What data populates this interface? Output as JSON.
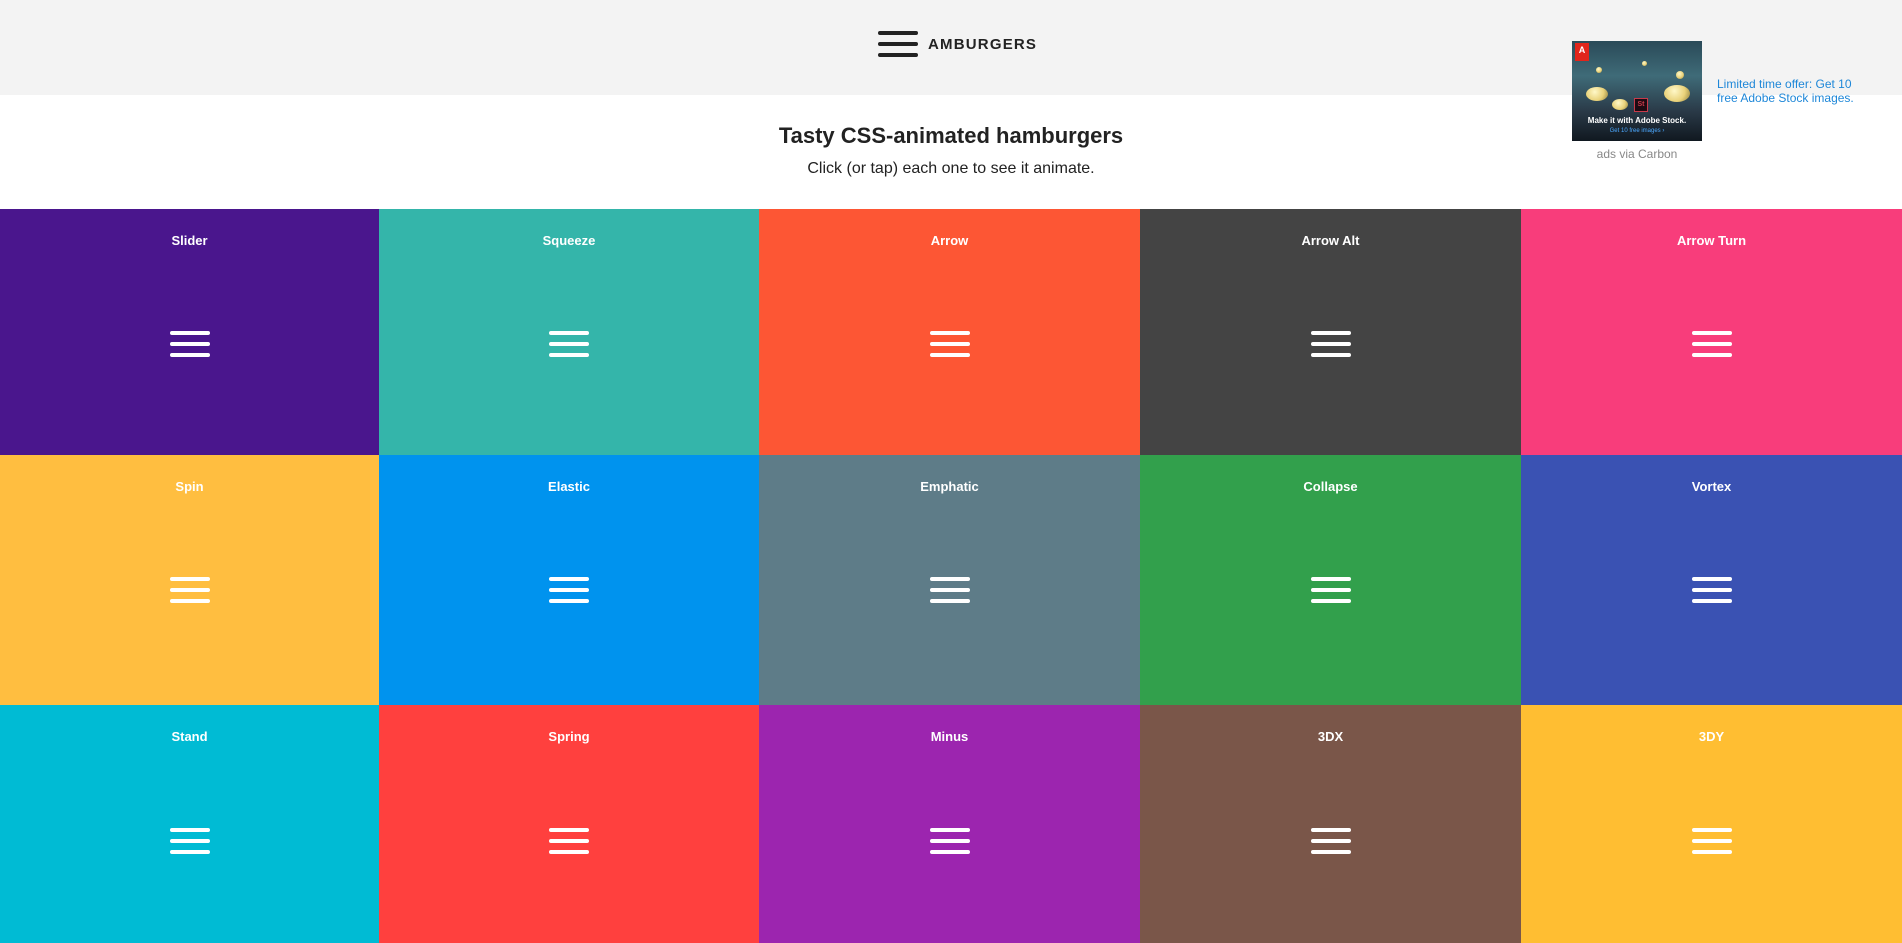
{
  "header": {
    "brand_text": "AMBURGERS",
    "brand_icon": "hamburger-icon"
  },
  "ad": {
    "image_caption": "Make it with Adobe Stock.",
    "image_subcaption": "Get 10 free images ›",
    "logo_text": "A",
    "badge_text": "St",
    "text": "Limited time offer: Get 10 free Adobe Stock images.",
    "via": "ads via Carbon"
  },
  "hero": {
    "title": "Tasty CSS-animated hamburgers",
    "subtitle": "Click (or tap) each one to see it animate."
  },
  "tiles": [
    {
      "label": "Slider",
      "color": "#4a168d"
    },
    {
      "label": "Squeeze",
      "color": "#34b5aa"
    },
    {
      "label": "Arrow",
      "color": "#fd5634"
    },
    {
      "label": "Arrow Alt",
      "color": "#444444"
    },
    {
      "label": "Arrow Turn",
      "color": "#f83d7b"
    },
    {
      "label": "Spin",
      "color": "#ffbe40"
    },
    {
      "label": "Elastic",
      "color": "#0093ee"
    },
    {
      "label": "Emphatic",
      "color": "#5e7c88"
    },
    {
      "label": "Collapse",
      "color": "#32a04c"
    },
    {
      "label": "Vortex",
      "color": "#3a52b3"
    },
    {
      "label": "Stand",
      "color": "#00bbd4"
    },
    {
      "label": "Spring",
      "color": "#ff403e"
    },
    {
      "label": "Minus",
      "color": "#9c25af"
    },
    {
      "label": "3DX",
      "color": "#7a5649"
    },
    {
      "label": "3DY",
      "color": "#ffbe32"
    }
  ]
}
